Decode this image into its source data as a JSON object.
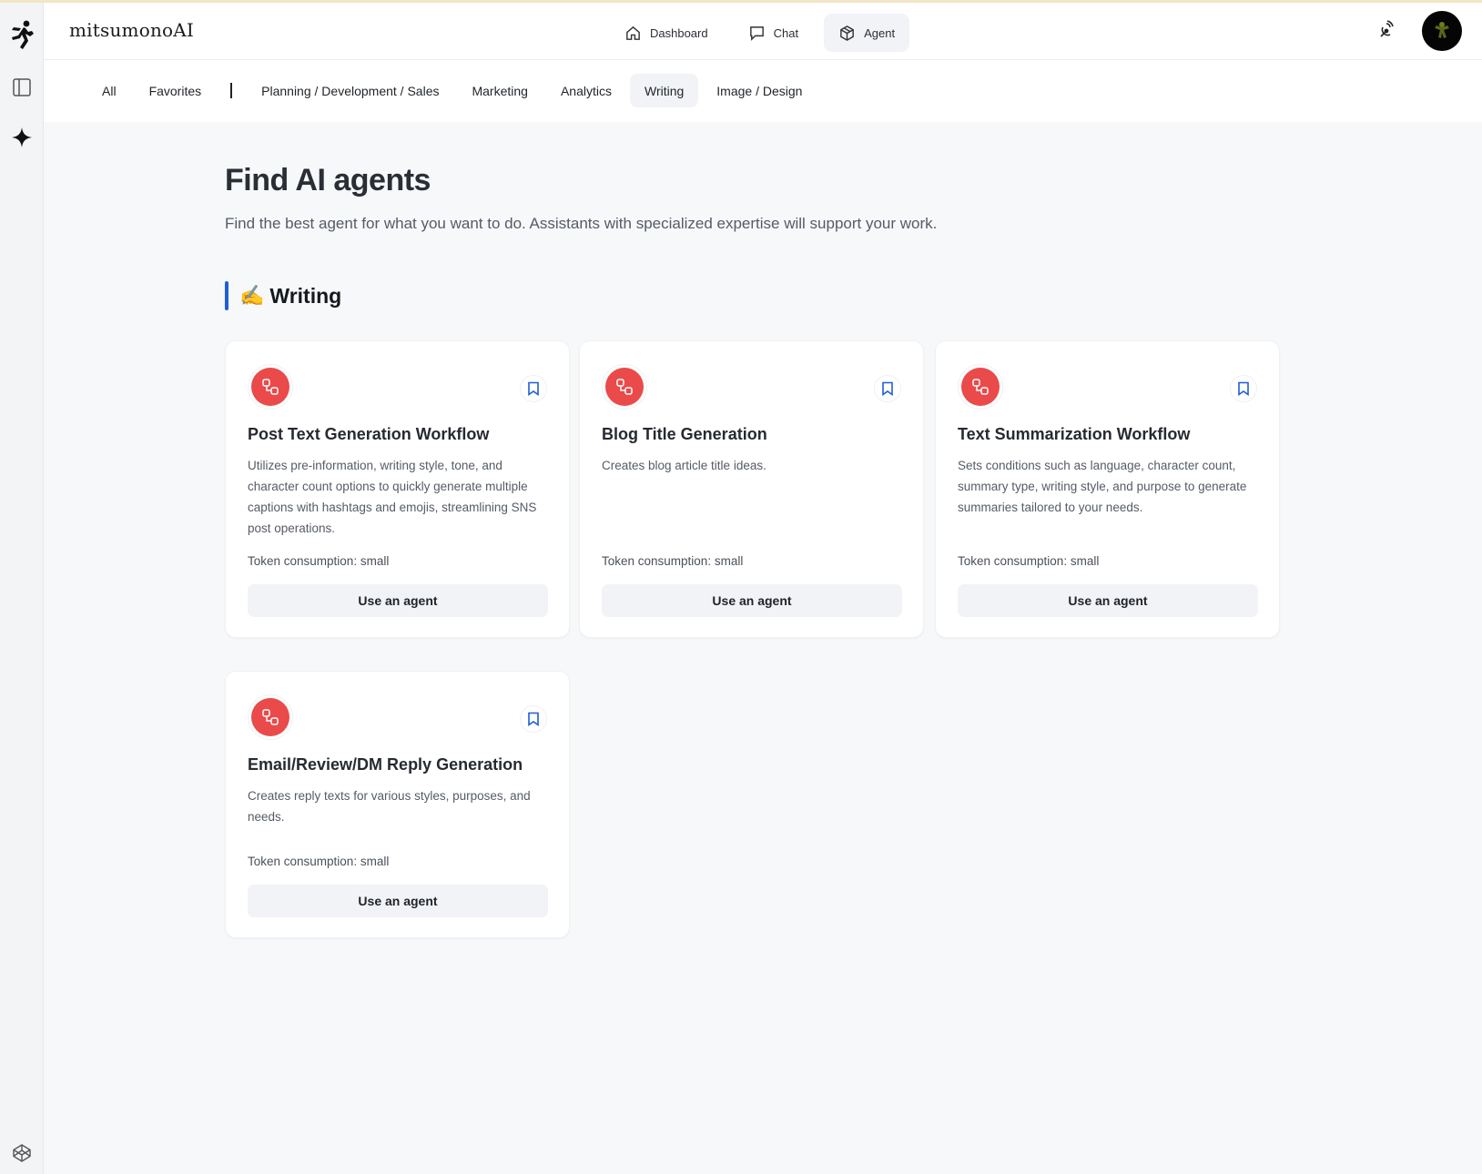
{
  "app": {
    "brand": "mitsumonoAI"
  },
  "topnav": [
    {
      "label": "Dashboard",
      "icon": "home-icon"
    },
    {
      "label": "Chat",
      "icon": "chat-bubble-icon"
    },
    {
      "label": "Agent",
      "icon": "cube-icon",
      "active": true
    }
  ],
  "tabs": {
    "all": "All",
    "favorites": "Favorites",
    "separator": "|",
    "items": [
      "Planning / Development / Sales",
      "Marketing",
      "Analytics",
      "Writing",
      "Image / Design"
    ],
    "active": "Writing"
  },
  "page": {
    "title": "Find AI agents",
    "subtitle": "Find the best agent for what you want to do. Assistants with specialized expertise will support your work."
  },
  "section": {
    "emoji": "✍️",
    "label": "Writing",
    "accent": "#1d5fd6"
  },
  "cards": [
    {
      "title": "Post Text Generation Workflow",
      "description": "Utilizes pre-information, writing style, tone, and character count options to quickly generate multiple captions with hashtags and emojis, streamlining SNS post operations.",
      "token": "Token consumption: small",
      "button": "Use an agent"
    },
    {
      "title": "Blog Title Generation",
      "description": "Creates blog article title ideas.",
      "token": "Token consumption: small",
      "button": "Use an agent"
    },
    {
      "title": "Text Summarization Workflow",
      "description": "Sets conditions such as language, character count, summary type, writing style, and purpose to generate summaries tailored to your needs.",
      "token": "Token consumption: small",
      "button": "Use an agent"
    },
    {
      "title": "Email/Review/DM Reply Generation",
      "description": "Creates reply texts for various styles, purposes, and needs.",
      "token": "Token consumption: small",
      "button": "Use an agent"
    }
  ],
  "colors": {
    "agent_icon": "#ea4a4a",
    "bookmark": "#1d5fd6",
    "background": "#f7f8fa"
  }
}
